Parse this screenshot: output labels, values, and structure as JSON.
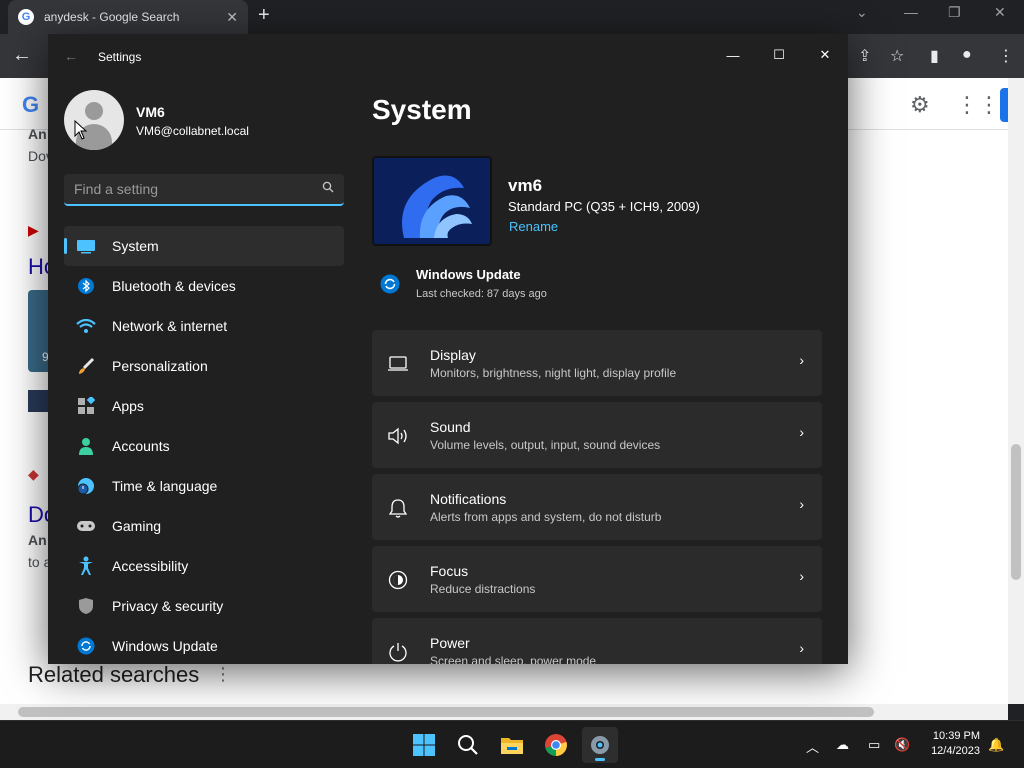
{
  "browser": {
    "tab_title": "anydesk - Google Search",
    "related_heading": "Related searches",
    "partial_texts": [
      "An",
      "Dov",
      "Ho",
      "Do",
      "An",
      "to a"
    ],
    "partial_number": "9"
  },
  "settings": {
    "window_title": "Settings",
    "profile": {
      "name": "VM6",
      "email": "VM6@collabnet.local"
    },
    "search": {
      "placeholder": "Find a setting"
    },
    "nav": [
      {
        "label": "System",
        "icon": "system-monitor-icon",
        "active": true
      },
      {
        "label": "Bluetooth & devices",
        "icon": "bluetooth-icon"
      },
      {
        "label": "Network & internet",
        "icon": "wifi-icon"
      },
      {
        "label": "Personalization",
        "icon": "paintbrush-icon"
      },
      {
        "label": "Apps",
        "icon": "apps-icon"
      },
      {
        "label": "Accounts",
        "icon": "accounts-icon"
      },
      {
        "label": "Time & language",
        "icon": "time-language-icon"
      },
      {
        "label": "Gaming",
        "icon": "gaming-controller-icon"
      },
      {
        "label": "Accessibility",
        "icon": "accessibility-icon"
      },
      {
        "label": "Privacy & security",
        "icon": "shield-icon"
      },
      {
        "label": "Windows Update",
        "icon": "windows-update-icon"
      }
    ],
    "main": {
      "title": "System",
      "device": {
        "name": "vm6",
        "model": "Standard PC (Q35 + ICH9, 2009)",
        "rename_label": "Rename"
      },
      "update": {
        "title": "Windows Update",
        "status": "Last checked: 87 days ago"
      },
      "cards": [
        {
          "title": "Display",
          "subtitle": "Monitors, brightness, night light, display profile",
          "icon": "display-icon"
        },
        {
          "title": "Sound",
          "subtitle": "Volume levels, output, input, sound devices",
          "icon": "speaker-icon"
        },
        {
          "title": "Notifications",
          "subtitle": "Alerts from apps and system, do not disturb",
          "icon": "bell-icon"
        },
        {
          "title": "Focus",
          "subtitle": "Reduce distractions",
          "icon": "focus-icon"
        },
        {
          "title": "Power",
          "subtitle": "Screen and sleep, power mode",
          "icon": "power-icon"
        }
      ]
    }
  },
  "taskbar": {
    "time": "10:39 PM",
    "date": "12/4/2023",
    "apps": [
      "windows-start-icon",
      "search-icon",
      "file-explorer-icon",
      "chrome-icon",
      "settings-gear-icon"
    ]
  },
  "colors": {
    "accent": "#4cc2ff",
    "link": "#1a0dab",
    "window_bg": "#202020",
    "card_bg": "#2b2b2b"
  }
}
